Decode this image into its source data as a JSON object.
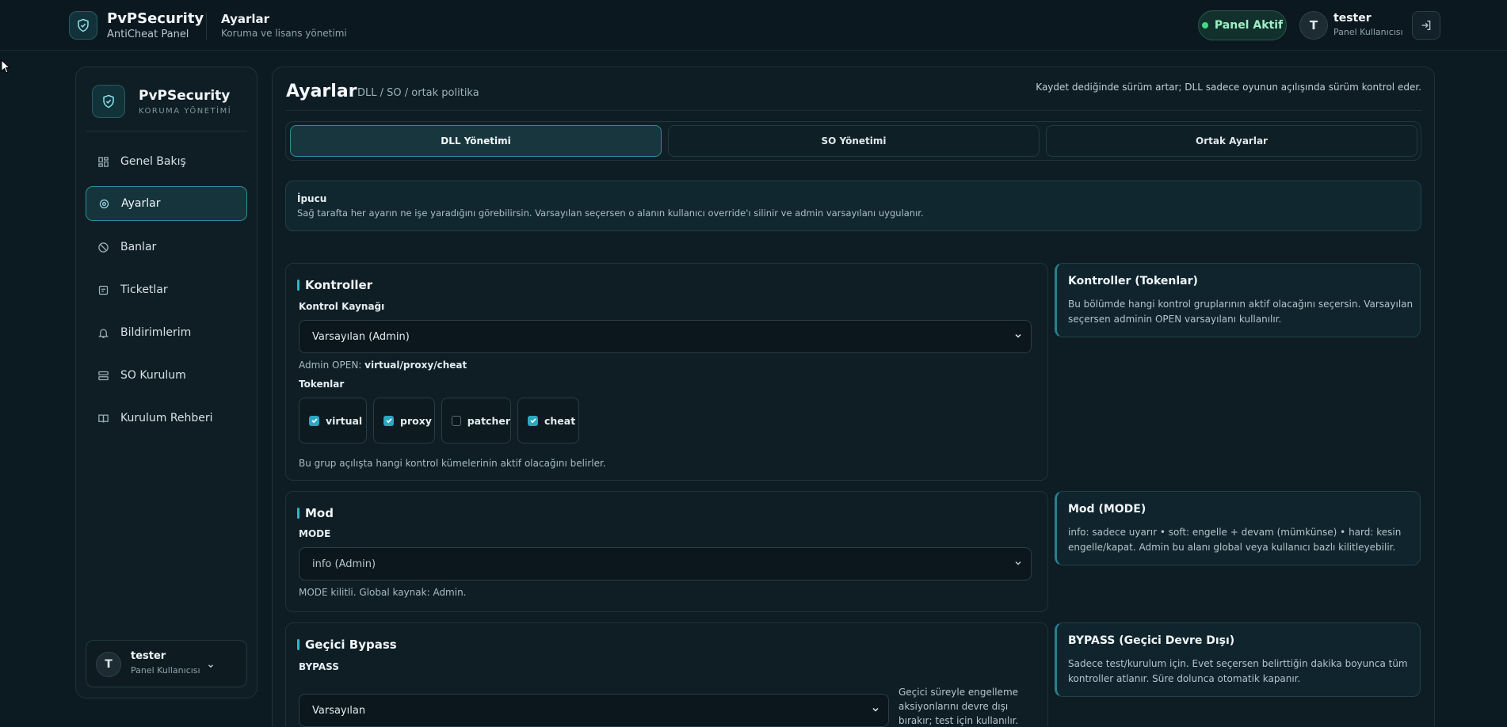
{
  "topbar": {
    "brand_title": "PvPSecurity",
    "brand_subtitle": "AntiCheat Panel",
    "page_title": "Ayarlar",
    "page_subtitle": "Koruma ve lisans yönetimi",
    "status_label": "Panel Aktif",
    "avatar_initial": "T",
    "user_name": "tester",
    "user_role": "Panel Kullanıcısı"
  },
  "sidebar": {
    "brand_title": "PvPSecurity",
    "brand_subtitle": "KORUMA YÖNETİMİ",
    "items": [
      {
        "label": "Genel Bakış",
        "icon": "grid-icon"
      },
      {
        "label": "Ayarlar",
        "icon": "gear-icon",
        "active": true
      },
      {
        "label": "Banlar",
        "icon": "ban-icon"
      },
      {
        "label": "Ticketlar",
        "icon": "ticket-icon"
      },
      {
        "label": "Bildirimlerim",
        "icon": "bell-icon"
      },
      {
        "label": "SO Kurulum",
        "icon": "server-icon"
      },
      {
        "label": "Kurulum Rehberi",
        "icon": "book-icon"
      }
    ],
    "user": {
      "initial": "T",
      "name": "tester",
      "role": "Panel Kullanıcısı"
    }
  },
  "main": {
    "title": "Ayarlar",
    "breadcrumb": "DLL / SO / ortak politika",
    "hint": "Kaydet dediğinde sürüm artar; DLL sadece oyunun açılışında sürüm kontrol eder.",
    "tabs": [
      {
        "label": "DLL Yönetimi",
        "active": true
      },
      {
        "label": "SO Yönetimi",
        "active": false
      },
      {
        "label": "Ortak Ayarlar",
        "active": false
      }
    ],
    "tip": {
      "title": "İpucu",
      "text": "Sağ tarafta her ayarın ne işe yaradığını görebilirsin. Varsayılan seçersen o alanın kullanıcı override'ı silinir ve admin varsayılanı uygulanır."
    },
    "kontroller": {
      "title": "Kontroller",
      "source_label": "Kontrol Kaynağı",
      "source_value": "Varsayılan (Admin)",
      "admin_open_prefix": "Admin OPEN:",
      "admin_open_value": "virtual/proxy/cheat",
      "tokens_label": "Tokenlar",
      "tokens": [
        {
          "label": "virtual",
          "checked": true
        },
        {
          "label": "proxy",
          "checked": true
        },
        {
          "label": "patcher",
          "checked": false
        },
        {
          "label": "cheat",
          "checked": true
        }
      ],
      "footnote": "Bu grup açılışta hangi kontrol kümelerinin aktif olacağını belirler."
    },
    "mod": {
      "title": "Mod",
      "field_label": "MODE",
      "value": "info (Admin)",
      "note": "MODE kilitli. Global kaynak: Admin."
    },
    "bypass": {
      "title": "Geçici Bypass",
      "field_label": "BYPASS",
      "value": "Varsayılan",
      "side_note": "Geçici süreyle engelleme aksiyonlarını devre dışı bırakır; test için kullanılır."
    },
    "info_cards": [
      {
        "title": "Kontroller (Tokenlar)",
        "text": "Bu bölümde hangi kontrol gruplarının aktif olacağını seçersin. Varsayılan seçersen adminin OPEN varsayılanı kullanılır."
      },
      {
        "title": "Mod (MODE)",
        "text": "info: sadece uyarır • soft: engelle + devam (mümkünse) • hard: kesin engelle/kapat. Admin bu alanı global veya kullanıcı bazlı kilitleyebilir."
      },
      {
        "title": "BYPASS (Geçici Devre Dışı)",
        "text": "Sadece test/kurulum için. Evet seçersen belirttiğin dakika boyunca tüm kontroller atlanır. Süre dolunca otomatik kapanır."
      }
    ]
  },
  "colors": {
    "background": "#0c1a21",
    "accent": "#2fb6c6",
    "status_green": "#3ddc84"
  }
}
